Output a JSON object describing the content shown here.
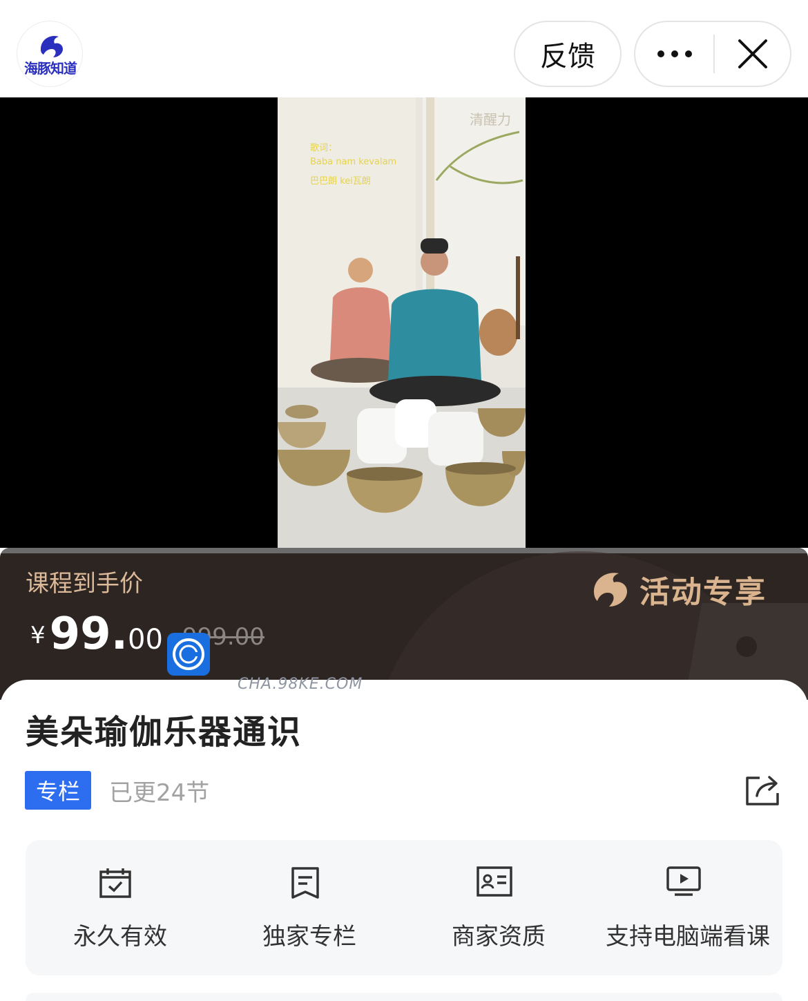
{
  "header": {
    "logo_text": "海豚知道",
    "feedback_label": "反馈",
    "more_icon": "more-dots-icon",
    "close_icon": "close-icon"
  },
  "video": {
    "watermark": "清醒力",
    "lyrics": [
      "歌词：",
      "Baba nam kevalam",
      "巴巴朗 kei瓦朗"
    ]
  },
  "price": {
    "label": "课程到手价",
    "currency": "¥",
    "integer": "99.",
    "decimal": "00",
    "original": "999.00",
    "promo": "活动专享"
  },
  "overlay": {
    "site_text": "CHA.98KE.COM"
  },
  "course": {
    "title": "美朵瑜伽乐器通识",
    "tag": "专栏",
    "updated": "已更24节",
    "share_icon": "share-icon"
  },
  "features": [
    {
      "label": "永久有效",
      "icon": "calendar-check-icon"
    },
    {
      "label": "独家专栏",
      "icon": "document-icon"
    },
    {
      "label": "商家资质",
      "icon": "id-card-icon"
    },
    {
      "label": "支持电脑端看课",
      "icon": "monitor-play-icon"
    }
  ],
  "colors": {
    "accent_blue": "#2d6ef0",
    "price_panel": "#2d2522",
    "gold": "#d9b48f"
  }
}
